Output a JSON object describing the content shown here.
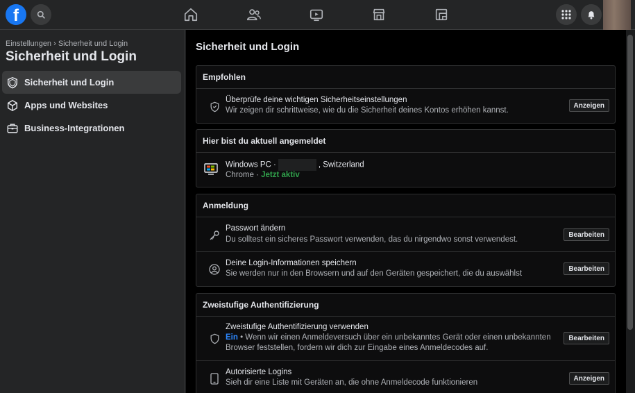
{
  "nav": {
    "logo_letter": "f",
    "icons": [
      "home-icon",
      "friends-icon",
      "watch-icon",
      "marketplace-icon",
      "groups-icon"
    ],
    "right_icons": [
      "menu-grid-icon",
      "notifications-icon"
    ]
  },
  "sidebar": {
    "breadcrumb": "Einstellungen › Sicherheit und Login",
    "title": "Sicherheit und Login",
    "items": [
      {
        "label": "Sicherheit und Login",
        "icon": "shield-icon",
        "active": true
      },
      {
        "label": "Apps und Websites",
        "icon": "cube-icon",
        "active": false
      },
      {
        "label": "Business-Integrationen",
        "icon": "briefcase-icon",
        "active": false
      }
    ]
  },
  "main": {
    "title": "Sicherheit und Login",
    "sections": {
      "recommended": {
        "heading": "Empfohlen",
        "row": {
          "title": "Überprüfe deine wichtigen Sicherheitseinstellungen",
          "desc": "Wir zeigen dir schrittweise, wie du die Sicherheit deines Kontos erhöhen kannst.",
          "button": "Anzeigen"
        }
      },
      "logged_in": {
        "heading": "Hier bist du aktuell angemeldet",
        "device": "Windows PC ·",
        "location": ", Switzerland",
        "browser": "Chrome ·",
        "status": "Jetzt aktiv"
      },
      "login": {
        "heading": "Anmeldung",
        "rows": [
          {
            "title": "Passwort ändern",
            "desc": "Du solltest ein sicheres Passwort verwenden, das du nirgendwo sonst verwendest.",
            "button": "Bearbeiten"
          },
          {
            "title": "Deine Login-Informationen speichern",
            "desc": "Sie werden nur in den Browsern und auf den Geräten gespeichert, die du auswählst",
            "button": "Bearbeiten"
          }
        ]
      },
      "two_factor": {
        "heading": "Zweistufige Authentifizierung",
        "rows": [
          {
            "title": "Zweistufige Authentifizierung verwenden",
            "state": "Ein",
            "desc1": " • Wenn wir einen Anmeldeversuch über ein unbekanntes Gerät oder einen unbekannten",
            "desc2": "Browser feststellen, fordern wir dich zur Eingabe eines Anmeldecodes auf.",
            "button": "Bearbeiten"
          },
          {
            "title": "Autorisierte Logins",
            "desc": "Sieh dir eine Liste mit Geräten an, die ohne Anmeldecode funktionieren",
            "button": "Anzeigen"
          }
        ]
      }
    }
  },
  "colors": {
    "brand": "#1877f2",
    "active_green": "#31a24c",
    "link_blue": "#2d88ff"
  }
}
